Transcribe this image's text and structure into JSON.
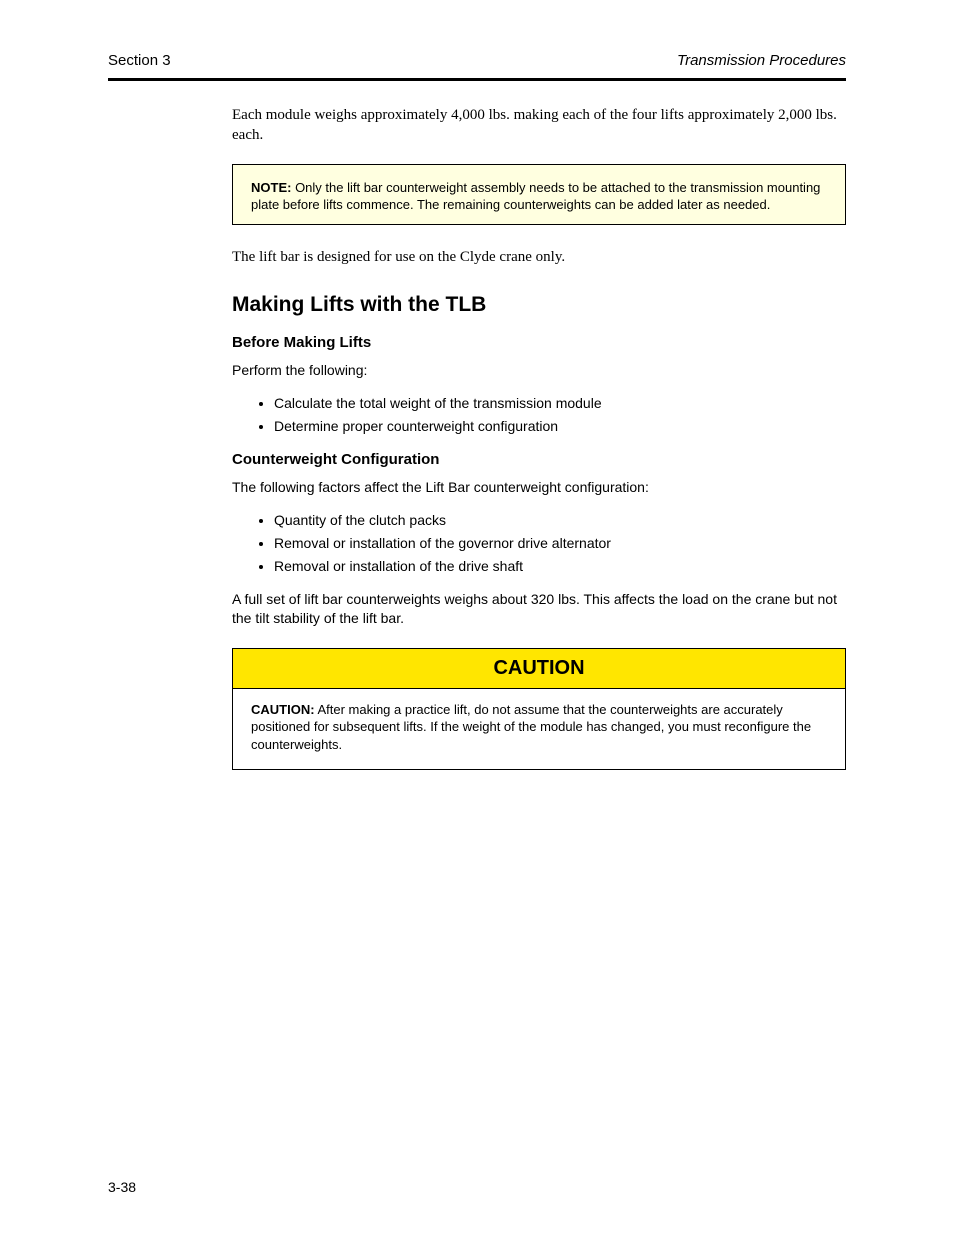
{
  "header": {
    "left": "Section 3",
    "right": "Transmission Procedures"
  },
  "intro": "Each module weighs approximately 4,000 lbs. making each of the four lifts approximately 2,000 lbs. each.",
  "note": {
    "label": "NOTE:",
    "text": " Only the lift bar counterweight assembly needs to be attached to the transmission mounting plate before lifts commence. The remaining counterweights can be added later as needed."
  },
  "para_after_note": "The lift bar is designed for use on the Clyde crane only.",
  "heading_main": "Making Lifts with the TLB",
  "h3_before": "Before Making Lifts",
  "lead_perform": "Perform the following:",
  "before_list": [
    "Calculate the total weight of the transmission module",
    "Determine proper counterweight configuration"
  ],
  "h3_counter": "Counterweight Configuration",
  "lead_affect": "The following factors affect the Lift Bar counterweight configuration:",
  "config_list": [
    "Quantity of the clutch packs",
    "Removal or installation of the governor drive alternator",
    "Removal or installation of the drive shaft"
  ],
  "config_para": "A full set of lift bar counterweights weighs about 320 lbs. This affects the load on the crane but not the tilt stability of the lift bar.",
  "caution": {
    "header": "CAUTION",
    "label": "CAUTION:",
    "body": " After making a practice lift, do not assume that the counterweights are accurately positioned for subsequent lifts. If the weight of the module has changed, you must reconfigure the counterweights."
  },
  "page_number": "3-38"
}
